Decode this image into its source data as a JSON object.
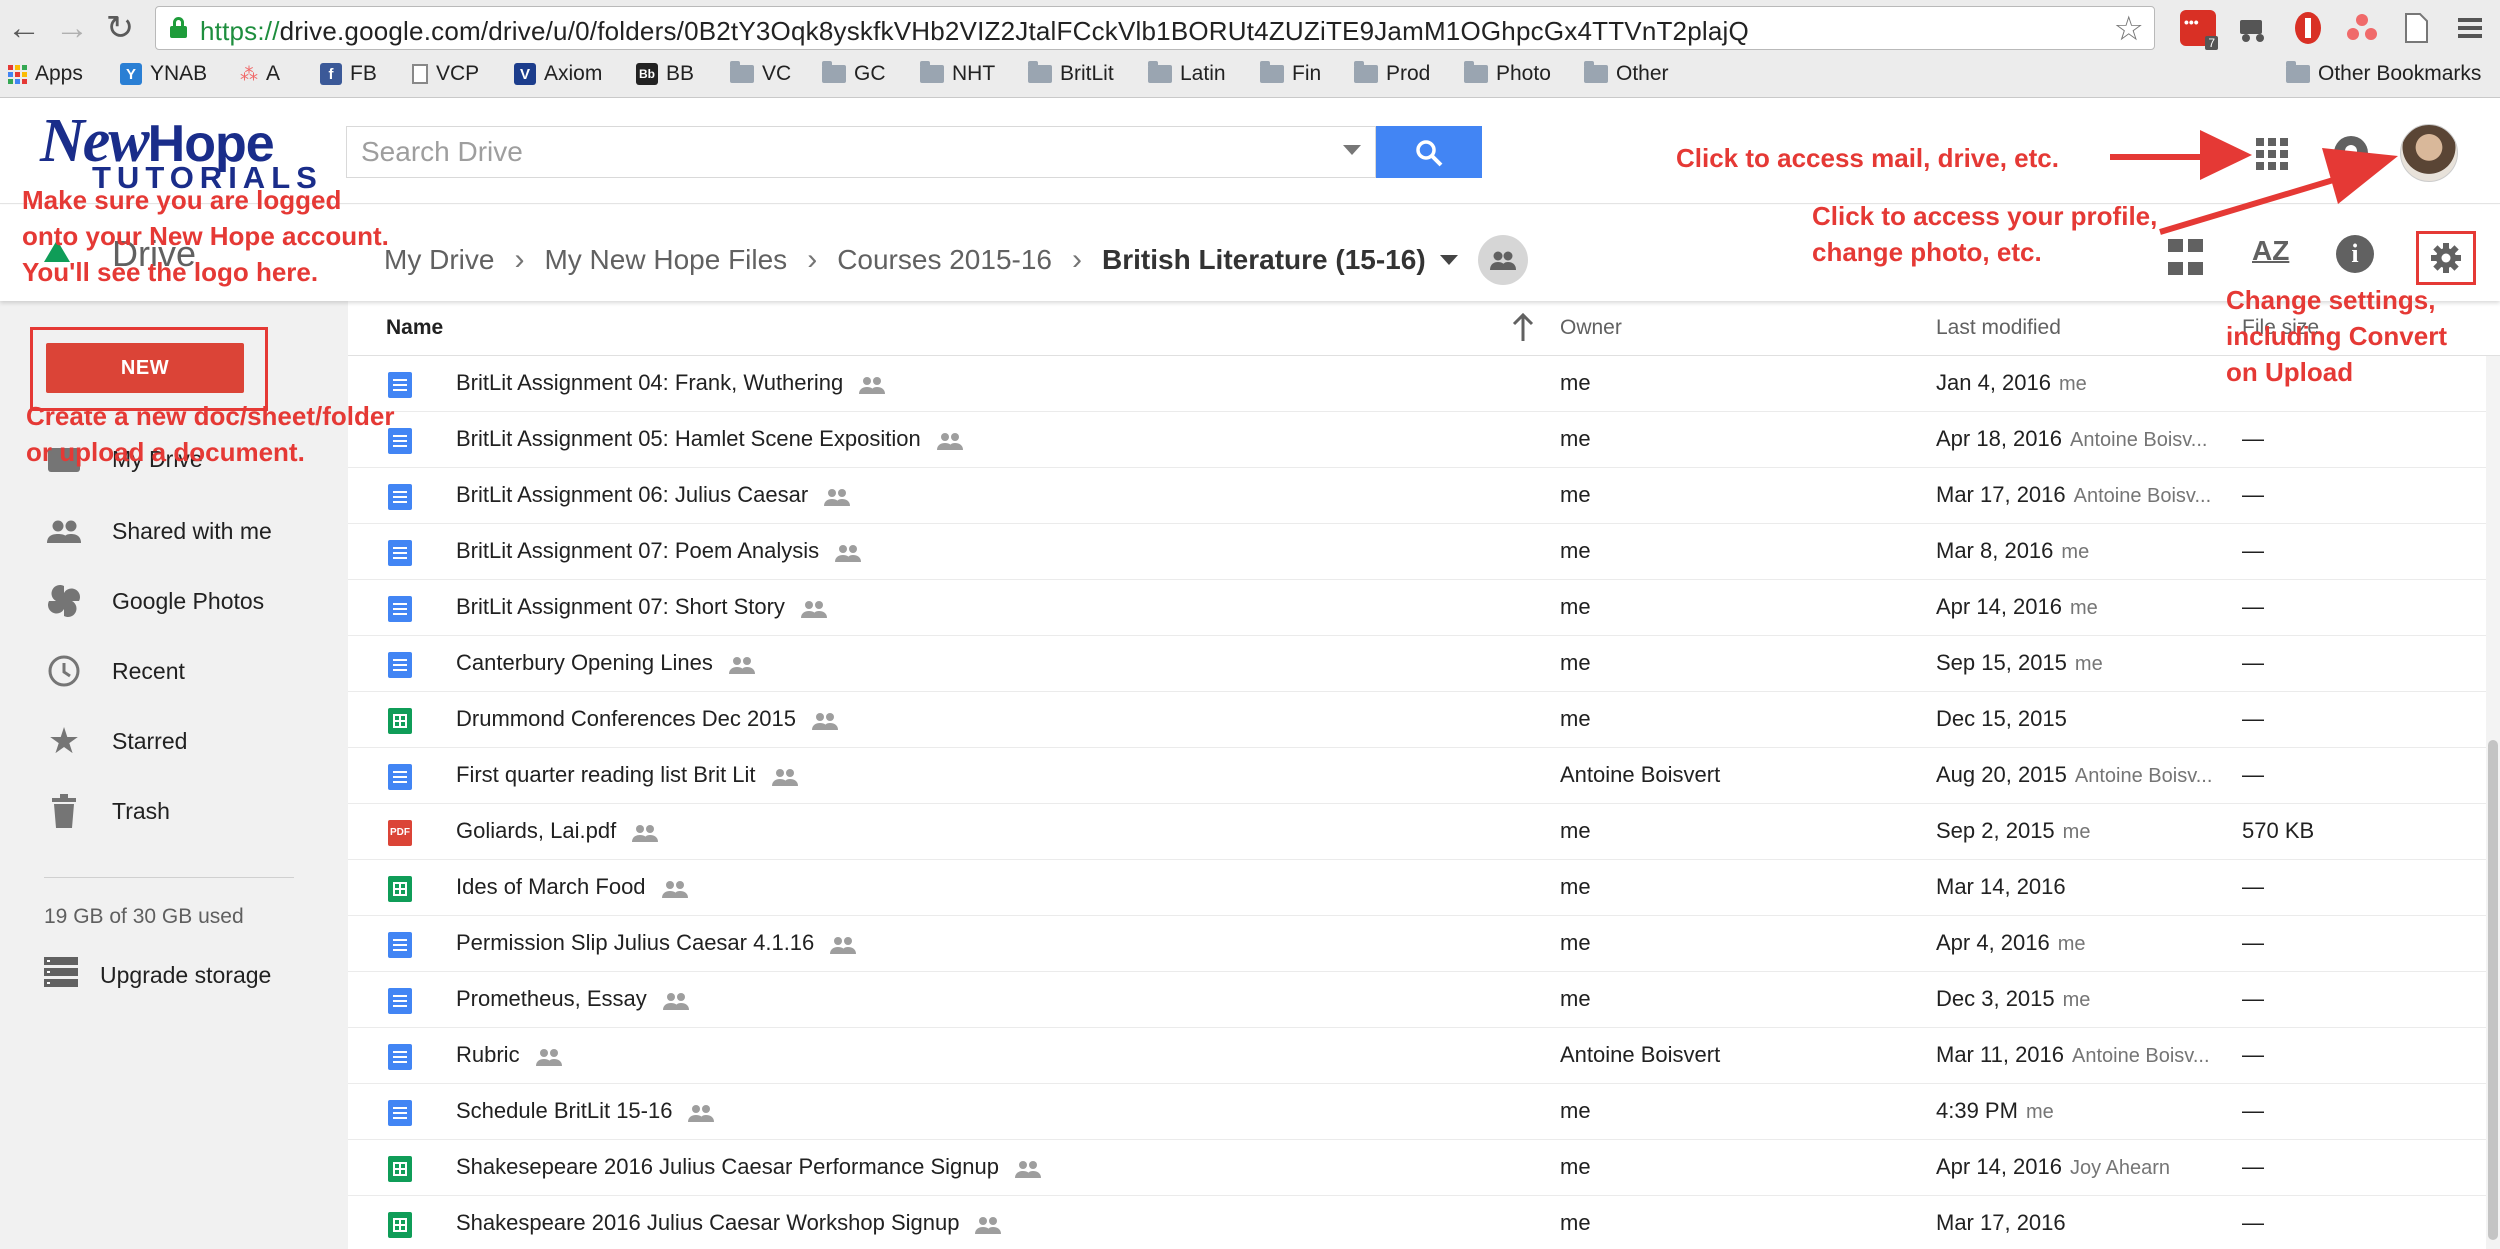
{
  "browser": {
    "url_scheme": "https://",
    "url_rest": "drive.google.com/drive/u/0/folders/0B2tY3Oqk8yskfkVHb2VIZ2JtalFCckVlb1BORUt4ZUZiTE9JamM1OGhpcGx4TTVnT2plajQ",
    "bookmarks": [
      {
        "label": "Apps",
        "kind": "apps-grid-icon"
      },
      {
        "label": "YNAB",
        "kind": "ynab-icon"
      },
      {
        "label": "A",
        "kind": "asana-icon"
      },
      {
        "label": "FB",
        "kind": "facebook-icon"
      },
      {
        "label": "VCP",
        "kind": "page-icon"
      },
      {
        "label": "Axiom",
        "kind": "axiom-icon"
      },
      {
        "label": "BB",
        "kind": "blackboard-icon"
      },
      {
        "label": "VC",
        "kind": "folder-icon"
      },
      {
        "label": "GC",
        "kind": "folder-icon"
      },
      {
        "label": "NHT",
        "kind": "folder-icon"
      },
      {
        "label": "BritLit",
        "kind": "folder-icon"
      },
      {
        "label": "Latin",
        "kind": "folder-icon"
      },
      {
        "label": "Fin",
        "kind": "folder-icon"
      },
      {
        "label": "Prod",
        "kind": "folder-icon"
      },
      {
        "label": "Photo",
        "kind": "folder-icon"
      },
      {
        "label": "Other",
        "kind": "folder-icon"
      }
    ],
    "other_bookmarks": "Other Bookmarks",
    "ext_badge": "7"
  },
  "logo": {
    "line1_a": "New",
    "line1_b": "Hope",
    "line2": "TUTORIALS"
  },
  "search": {
    "placeholder": "Search Drive"
  },
  "toolbar": {
    "app_name": "Drive",
    "crumbs": [
      "My Drive",
      "My New Hope Files",
      "Courses 2015-16"
    ],
    "current_folder": "British Literature (15-16)",
    "sort_label": "AZ",
    "info_label": "i"
  },
  "sidebar": {
    "new_label": "NEW",
    "items": [
      {
        "label": "My Drive",
        "icon": "my-drive-icon"
      },
      {
        "label": "Shared with me",
        "icon": "shared-with-me-icon"
      },
      {
        "label": "Google Photos",
        "icon": "google-photos-icon"
      },
      {
        "label": "Recent",
        "icon": "clock-icon"
      },
      {
        "label": "Starred",
        "icon": "star-icon"
      },
      {
        "label": "Trash",
        "icon": "trash-icon"
      }
    ],
    "storage": "19 GB of 30 GB used",
    "upgrade": "Upgrade storage"
  },
  "list": {
    "headers": {
      "name": "Name",
      "owner": "Owner",
      "modified": "Last modified",
      "size": "File size"
    },
    "rows": [
      {
        "type": "doc",
        "name": "BritLit Assignment 04: Frank, Wuthering",
        "owner": "me",
        "date": "Jan 4, 2016",
        "by": "me",
        "size": ""
      },
      {
        "type": "doc",
        "name": "BritLit Assignment 05: Hamlet Scene Exposition",
        "owner": "me",
        "date": "Apr 18, 2016",
        "by": "Antoine Boisv...",
        "size": "—"
      },
      {
        "type": "doc",
        "name": "BritLit Assignment 06: Julius Caesar",
        "owner": "me",
        "date": "Mar 17, 2016",
        "by": "Antoine Boisv...",
        "size": "—"
      },
      {
        "type": "doc",
        "name": "BritLit Assignment 07: Poem Analysis",
        "owner": "me",
        "date": "Mar 8, 2016",
        "by": "me",
        "size": "—"
      },
      {
        "type": "doc",
        "name": "BritLit Assignment 07: Short Story",
        "owner": "me",
        "date": "Apr 14, 2016",
        "by": "me",
        "size": "—"
      },
      {
        "type": "doc",
        "name": "Canterbury Opening Lines",
        "owner": "me",
        "date": "Sep 15, 2015",
        "by": "me",
        "size": "—"
      },
      {
        "type": "sheet",
        "name": "Drummond Conferences Dec 2015",
        "owner": "me",
        "date": "Dec 15, 2015",
        "by": "",
        "size": "—"
      },
      {
        "type": "doc",
        "name": "First quarter reading list Brit Lit",
        "owner": "Antoine Boisvert",
        "date": "Aug 20, 2015",
        "by": "Antoine Boisv...",
        "size": "—"
      },
      {
        "type": "pdf",
        "name": "Goliards, Lai.pdf",
        "owner": "me",
        "date": "Sep 2, 2015",
        "by": "me",
        "size": "570 KB"
      },
      {
        "type": "sheet",
        "name": "Ides of March Food",
        "owner": "me",
        "date": "Mar 14, 2016",
        "by": "",
        "size": "—"
      },
      {
        "type": "doc",
        "name": "Permission Slip Julius Caesar 4.1.16",
        "owner": "me",
        "date": "Apr 4, 2016",
        "by": "me",
        "size": "—"
      },
      {
        "type": "doc",
        "name": "Prometheus, Essay",
        "owner": "me",
        "date": "Dec 3, 2015",
        "by": "me",
        "size": "—"
      },
      {
        "type": "doc",
        "name": "Rubric",
        "owner": "Antoine Boisvert",
        "date": "Mar 11, 2016",
        "by": "Antoine Boisv...",
        "size": "—"
      },
      {
        "type": "doc",
        "name": "Schedule BritLit 15-16",
        "owner": "me",
        "date": "4:39 PM",
        "by": "me",
        "size": "—"
      },
      {
        "type": "sheet",
        "name": "Shakesepeare 2016 Julius Caesar Performance Signup",
        "owner": "me",
        "date": "Apr 14, 2016",
        "by": "Joy Ahearn",
        "size": "—"
      },
      {
        "type": "sheet",
        "name": "Shakespeare 2016 Julius Caesar Workshop Signup",
        "owner": "me",
        "date": "Mar 17, 2016",
        "by": "",
        "size": "—"
      }
    ]
  },
  "annotations": {
    "logo_note": [
      "Make sure you are logged",
      "onto your New Hope account.",
      "You'll see the logo here."
    ],
    "apps_note": "Click to access mail, drive, etc.",
    "profile_note": [
      "Click to access your profile,",
      "change photo, etc."
    ],
    "settings_note": [
      "Change settings,",
      "including Convert",
      "on Upload"
    ],
    "new_note": [
      "Create a new doc/sheet/folder",
      "or upload a document."
    ]
  },
  "colors": {
    "accent_blue": "#4285f4",
    "new_red": "#db4437",
    "annotation_red": "#e53935",
    "sheet_green": "#0f9d58"
  }
}
